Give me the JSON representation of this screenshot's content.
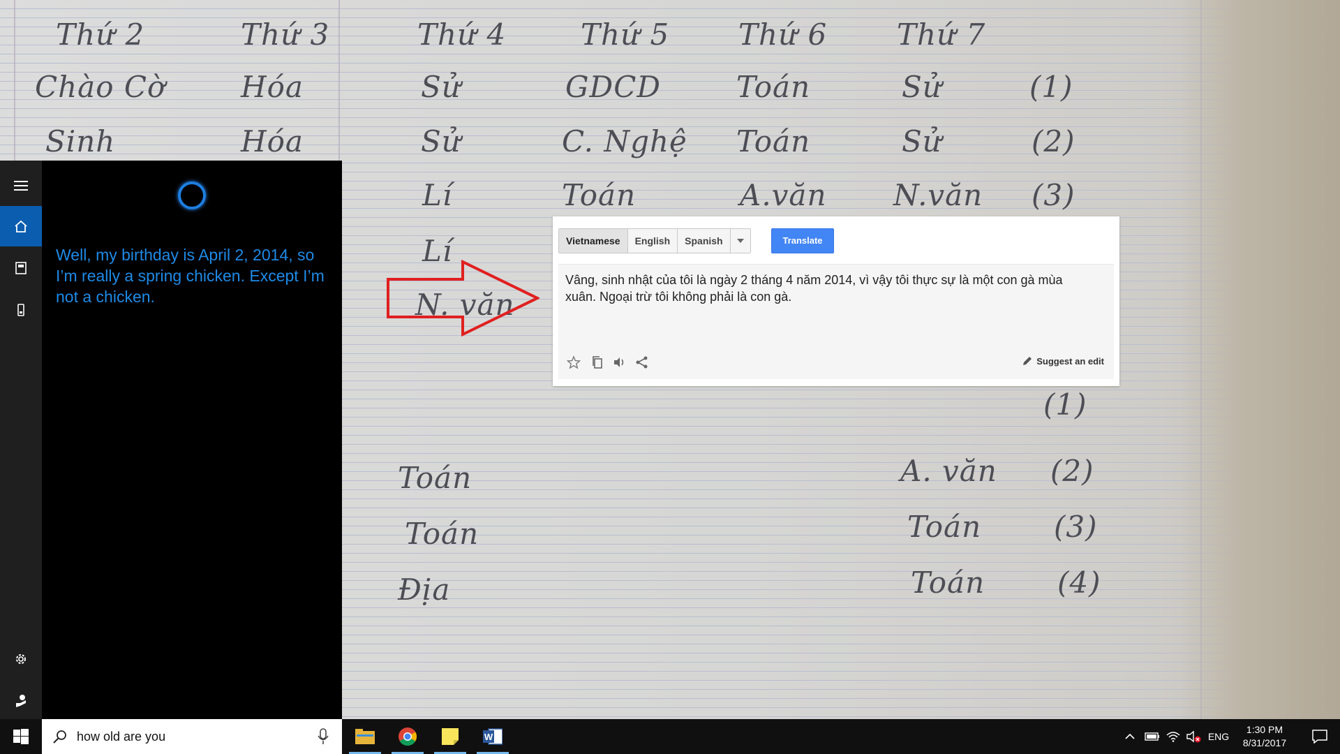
{
  "wallpaper": {
    "handwriting": [
      "Thứ 2",
      "Thứ 3",
      "Thứ 4",
      "Thứ 5",
      "Thứ 6",
      "Thứ 7",
      "Chào Cờ",
      "Hóa",
      "Sử",
      "GDCD",
      "Toán",
      "Sử",
      "(1)",
      "Sinh",
      "Hóa",
      "Sử",
      "C. Nghệ",
      "Toán",
      "Sử",
      "(2)",
      "Lí",
      "Toán",
      "A.văn",
      "N.văn",
      "(3)",
      "Lí",
      "N. văn",
      "(1)",
      "Toán",
      "A. văn",
      "(2)",
      "Toán",
      "Toán",
      "(3)",
      "Địa",
      "Toán",
      "(4)"
    ]
  },
  "cortana": {
    "response": "Well, my birthday is April 2, 2014, so I’m really a spring chicken. Except I’m not a chicken.",
    "rail_icons": [
      "hamburger-icon",
      "home-icon",
      "notebook-icon",
      "devices-icon",
      "settings-icon",
      "feedback-icon"
    ]
  },
  "translate": {
    "languages": [
      "Vietnamese",
      "English",
      "Spanish"
    ],
    "selected_language": "Vietnamese",
    "translate_label": "Translate",
    "result": "Vâng, sinh nhật của tôi là ngày 2 tháng 4 năm 2014, vì vậy tôi thực sự là một con gà mùa xuân. Ngoại trừ tôi không phải là con gà.",
    "suggest_edit_label": "Suggest an edit",
    "accent": "#4285f4"
  },
  "taskbar": {
    "search_value": "how old are you",
    "language": "ENG",
    "time": "1:30 PM",
    "date": "8/31/2017",
    "apps": [
      "file-explorer-icon",
      "chrome-icon",
      "sticky-notes-icon",
      "word-icon"
    ]
  },
  "colors": {
    "cortana_blue": "#1e8ae6",
    "rail_active": "#0b5db0",
    "arrow_red": "#e02020"
  }
}
